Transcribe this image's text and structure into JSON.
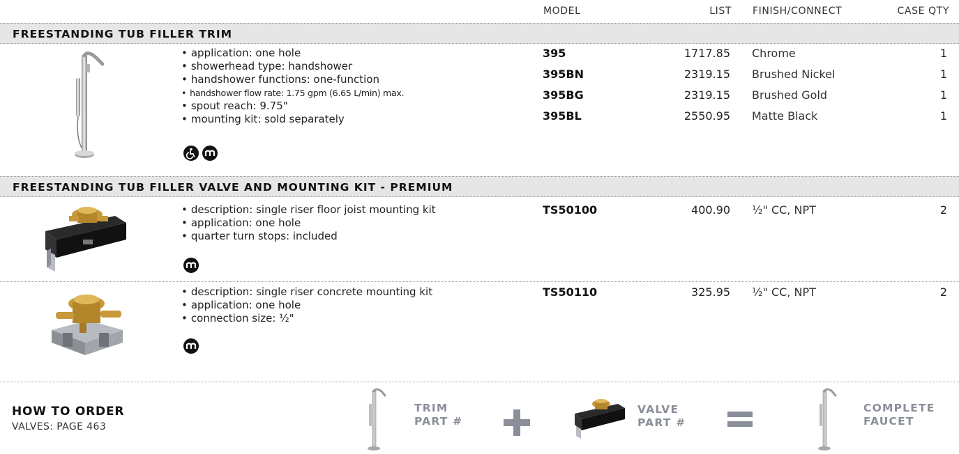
{
  "columns": {
    "model": "MODEL",
    "list": "LIST",
    "finish": "FINISH/CONNECT",
    "qty": "CASE QTY"
  },
  "sections": [
    {
      "title": "FREESTANDING TUB FILLER TRIM",
      "features": [
        "application: one hole",
        "showerhead type: handshower",
        "handshower functions: one-function",
        "handshower flow rate: 1.75 gpm (6.65 L/min) max.",
        "spout reach: 9.75\"",
        "mounting kit: sold separately"
      ],
      "icons": [
        "ada-compliant-icon",
        "m-press-fit-icon"
      ],
      "rows": [
        {
          "model": "395",
          "list": "1717.85",
          "finish": "Chrome",
          "qty": "1"
        },
        {
          "model": "395BN",
          "list": "2319.15",
          "finish": "Brushed Nickel",
          "qty": "1"
        },
        {
          "model": "395BG",
          "list": "2319.15",
          "finish": "Brushed Gold",
          "qty": "1"
        },
        {
          "model": "395BL",
          "list": "2550.95",
          "finish": "Matte Black",
          "qty": "1"
        }
      ]
    },
    {
      "title": "FREESTANDING TUB FILLER VALVE AND MOUNTING KIT - PREMIUM",
      "products": [
        {
          "features": [
            "description: single riser floor joist mounting kit",
            "application: one hole",
            "quarter turn stops: included"
          ],
          "icons": [
            "m-press-fit-icon"
          ],
          "model": "TS50100",
          "list": "400.90",
          "finish": "½\" CC, NPT",
          "qty": "2"
        },
        {
          "features": [
            "description: single riser concrete mounting kit",
            "application: one hole",
            "connection size: ½\""
          ],
          "icons": [
            "m-press-fit-icon"
          ],
          "model": "TS50110",
          "list": "325.95",
          "finish": "½\" CC, NPT",
          "qty": "2"
        }
      ]
    }
  ],
  "how_to_order": {
    "title": "HOW TO ORDER",
    "subtitle": "VALVES: PAGE 463",
    "trim_line1": "TRIM",
    "trim_line2": "PART #",
    "valve_line1": "VALVE",
    "valve_line2": "PART #",
    "complete_line1": "COMPLETE",
    "complete_line2": "FAUCET"
  }
}
